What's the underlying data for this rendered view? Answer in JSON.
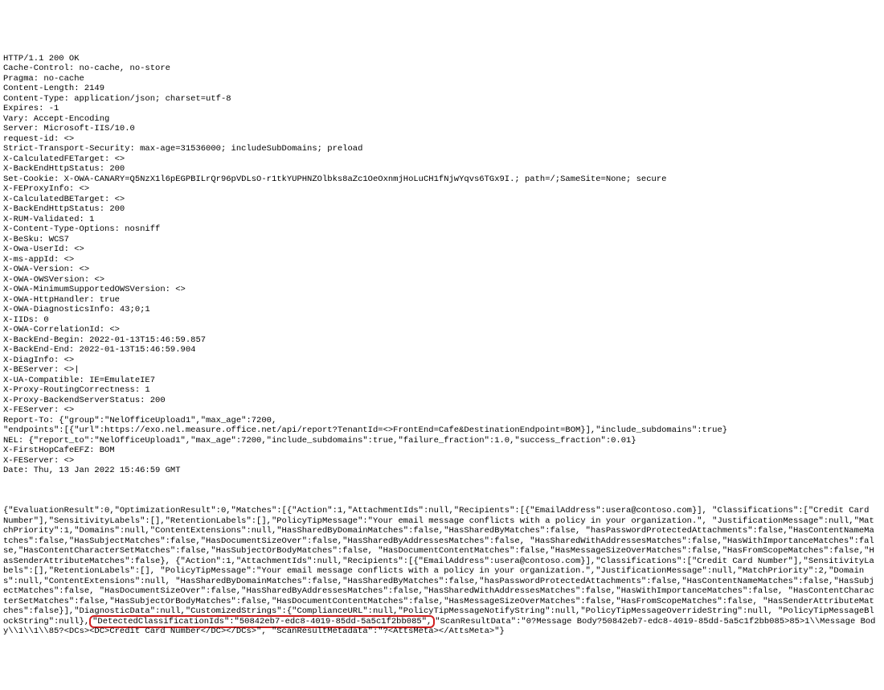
{
  "headers": {
    "statusLine": "HTTP/1.1 200 OK",
    "lines": [
      "Cache-Control: no-cache, no-store",
      "Pragma: no-cache",
      "Content-Length: 2149",
      "Content-Type: application/json; charset=utf-8",
      "Expires: -1",
      "Vary: Accept-Encoding",
      "Server: Microsoft-IIS/10.0",
      "request-id: <>",
      "Strict-Transport-Security: max-age=31536000; includeSubDomains; preload",
      "X-CalculatedFETarget: <>",
      "X-BackEndHttpStatus: 200",
      "Set-Cookie: X-OWA-CANARY=Q5NzX1l6pEGPBILrQr96pVDLsO-r1tkYUPHNZOlbks8aZc1OeOxnmjHoLuCH1fNjwYqvs6TGx9I.; path=/;SameSite=None; secure",
      "X-FEProxyInfo: <>",
      "X-CalculatedBETarget: <>",
      "X-BackEndHttpStatus: 200",
      "X-RUM-Validated: 1",
      "X-Content-Type-Options: nosniff",
      "X-BeSku: WCS7",
      "X-Owa-UserId: <>",
      "X-ms-appId: <>",
      "X-OWA-Version: <>",
      "X-OWA-OWSVersion: <>",
      "X-OWA-MinimumSupportedOWSVersion: <>",
      "X-OWA-HttpHandler: true",
      "X-OWA-DiagnosticsInfo: 43;0;1",
      "X-IIDs: 0",
      "X-OWA-CorrelationId: <>",
      "X-BackEnd-Begin: 2022-01-13T15:46:59.857",
      "X-BackEnd-End: 2022-01-13T15:46:59.904",
      "X-DiagInfo: <>",
      "X-BEServer: <>|",
      "X-UA-Compatible: IE=EmulateIE7",
      "X-Proxy-RoutingCorrectness: 1",
      "X-Proxy-BackendServerStatus: 200",
      "X-FEServer: <>",
      "Report-To: {\"group\":\"NelOfficeUpload1\",\"max_age\":7200,",
      "\"endpoints\":[{\"url\":https://exo.nel.measure.office.net/api/report?TenantId=<>FrontEnd=Cafe&DestinationEndpoint=BOM}],\"include_subdomains\":true}",
      "NEL: {\"report_to\":\"NelOfficeUpload1\",\"max_age\":7200,\"include_subdomains\":true,\"failure_fraction\":1.0,\"success_fraction\":0.01}",
      "X-FirstHopCafeEFZ: BOM",
      "X-FEServer: <>",
      "Date: Thu, 13 Jan 2022 15:46:59 GMT"
    ]
  },
  "body": {
    "pre": "{\"EvaluationResult\":0,\"OptimizationResult\":0,\"Matches\":[{\"Action\":1,\"AttachmentIds\":null,\"Recipients\":[{\"EmailAddress\":usera@contoso.com}], \"Classifications\":[\"Credit Card Number\"],\"SensitivityLabels\":[],\"RetentionLabels\":[],\"PolicyTipMessage\":\"Your email message conflicts with a policy in your organization.\", \"JustificationMessage\":null,\"MatchPriority\":1,\"Domains\":null,\"ContentExtensions\":null,\"HasSharedByDomainMatches\":false,\"HasSharedByMatches\":false, \"hasPasswordProtectedAttachments\":false,\"HasContentNameMatches\":false,\"HasSubjectMatches\":false,\"HasDocumentSizeOver\":false,\"HasSharedByAddressesMatches\":false, \"HasSharedWithAddressesMatches\":false,\"HasWithImportanceMatches\":false,\"HasContentCharacterSetMatches\":false,\"HasSubjectOrBodyMatches\":false, \"HasDocumentContentMatches\":false,\"HasMessageSizeOverMatches\":false,\"HasFromScopeMatches\":false,\"HasSenderAttributeMatches\":false}, {\"Action\":1,\"AttachmentIds\":null,\"Recipients\":[{\"EmailAddress\":usera@contoso.com}],\"Classifications\":[\"Credit Card Number\"],\"SensitivityLabels\":[],\"RetentionLabels\":[], \"PolicyTipMessage\":\"Your email message conflicts with a policy in your organization.\",\"JustificationMessage\":null,\"MatchPriority\":2,\"Domains\":null,\"ContentExtensions\":null, \"HasSharedByDomainMatches\":false,\"HasSharedByMatches\":false,\"hasPasswordProtectedAttachments\":false,\"HasContentNameMatches\":false,\"HasSubjectMatches\":false, \"HasDocumentSizeOver\":false,\"HasSharedByAddressesMatches\":false,\"HasSharedWithAddressesMatches\":false,\"HasWithImportanceMatches\":false, \"HasContentCharacterSetMatches\":false,\"HasSubjectOrBodyMatches\":false,\"HasDocumentContentMatches\":false,\"HasMessageSizeOverMatches\":false,\"HasFromScopeMatches\":false, \"HasSenderAttributeMatches\":false}],\"DiagnosticData\":null,\"CustomizedStrings\":{\"ComplianceURL\":null,\"PolicyTipMessageNotifyString\":null,\"PolicyTipMessageOverrideString\":null, \"PolicyTipMessageBlockString\":null},",
    "highlight": "\"DetectedClassificationIds\":\"50842eb7-edc8-4019-85dd-5a5c1f2bb085\",",
    "post": "\"ScanResultData\":\"0?Message Body?50842eb7-edc8-4019-85dd-5a5c1f2bb085>85>1\\\\Message Body\\\\1\\\\1\\\\85?<DCs><DC>Credit Card Number</DC></DCs>\", \"ScanResultMetadata\":\"?<AttsMeta></AttsMeta>\"}"
  }
}
